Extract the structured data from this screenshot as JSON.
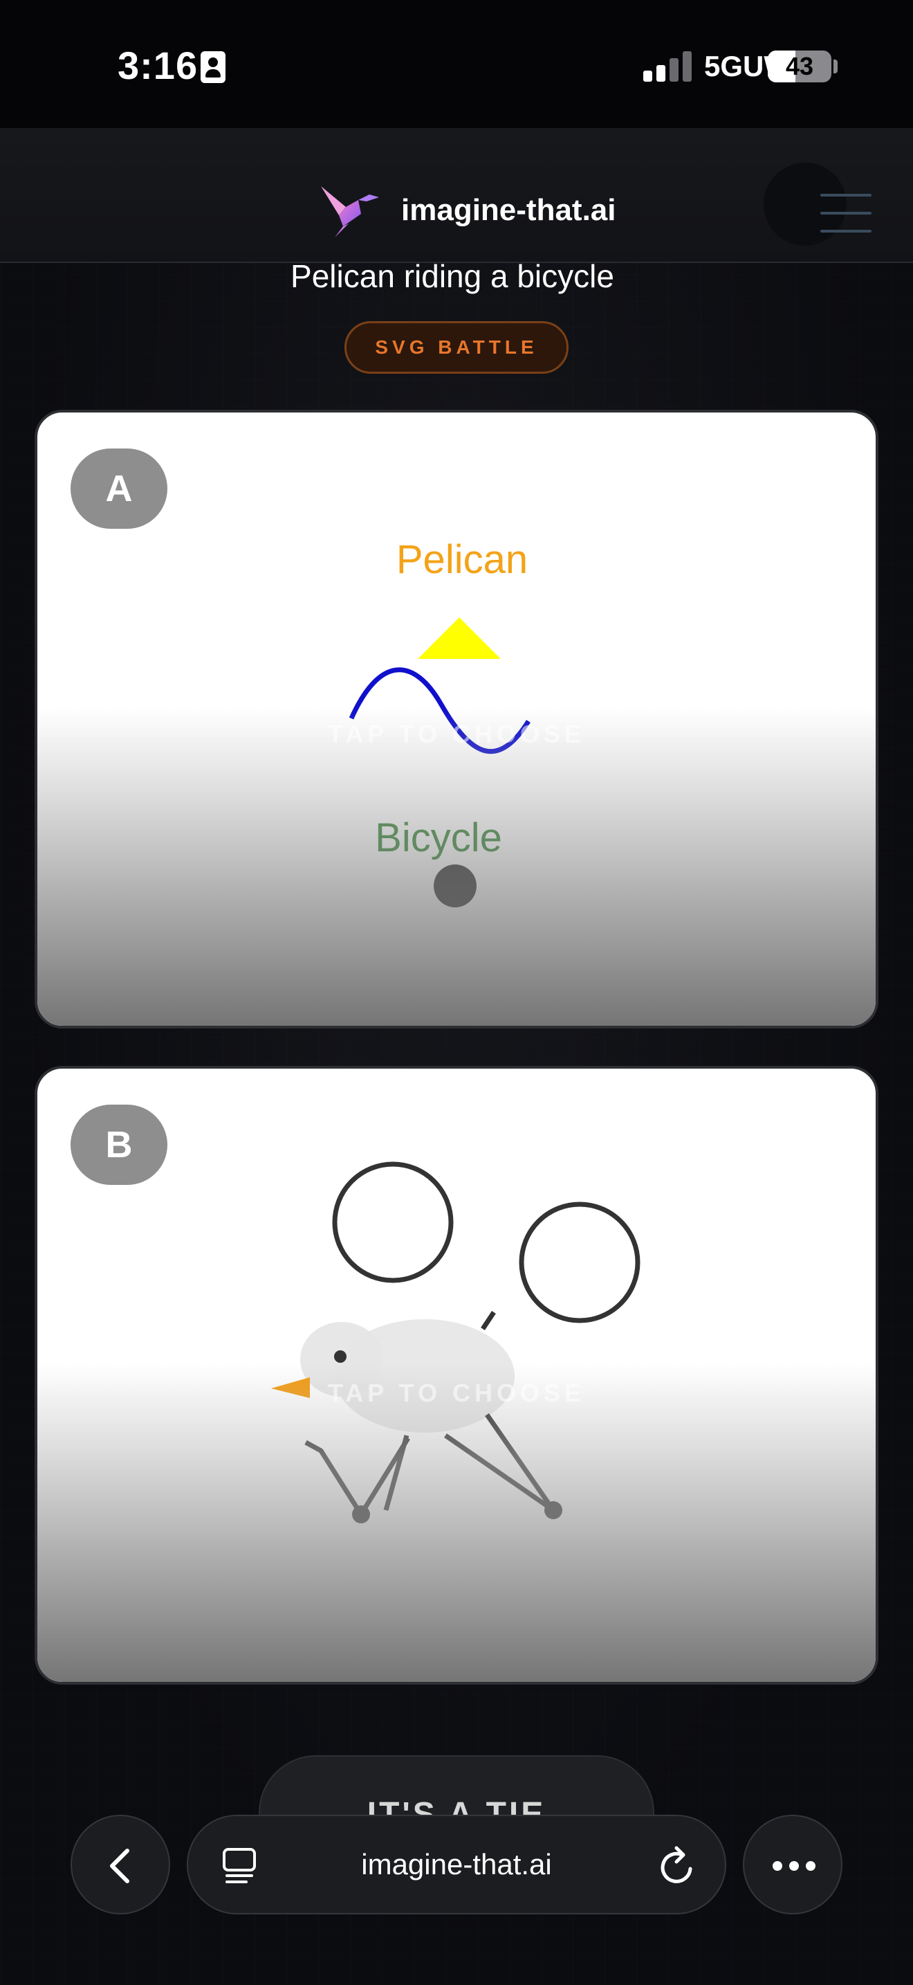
{
  "status_bar": {
    "time": "3:16",
    "network": "5GUW",
    "battery_level": "43",
    "battery_fraction": 0.43,
    "icons": [
      "person-card-icon",
      "signal-icon",
      "battery-icon"
    ]
  },
  "header": {
    "brand": "imagine-that.ai",
    "logo_icon": "hummingbird-logo-icon",
    "menu_icon": "hamburger-menu-icon"
  },
  "battle": {
    "prompt": "Pelican riding a bicycle",
    "badge": "SVG BATTLE"
  },
  "card_a": {
    "letter": "A",
    "tap_label": "TAP TO CHOOSE",
    "svg_text_pelican": "Pelican",
    "svg_text_bicycle": "Bicycle",
    "colors": {
      "pelican_text": "#f3a318",
      "bicycle_text": "#0b6b0b",
      "wave": "#1010cc",
      "triangle": "#ffff00"
    }
  },
  "card_b": {
    "letter": "B",
    "tap_label": "TAP TO CHOOSE",
    "colors": {
      "stroke": "#333333",
      "body": "#e6e6e6",
      "beak": "#f39c12"
    }
  },
  "tie_button": {
    "label": "IT'S A TIE"
  },
  "browser": {
    "url": "imagine-that.ai",
    "back_icon": "chevron-left-icon",
    "tabs_icon": "tabs-icon",
    "reload_icon": "reload-icon",
    "more_icon": "more-dots-icon"
  }
}
